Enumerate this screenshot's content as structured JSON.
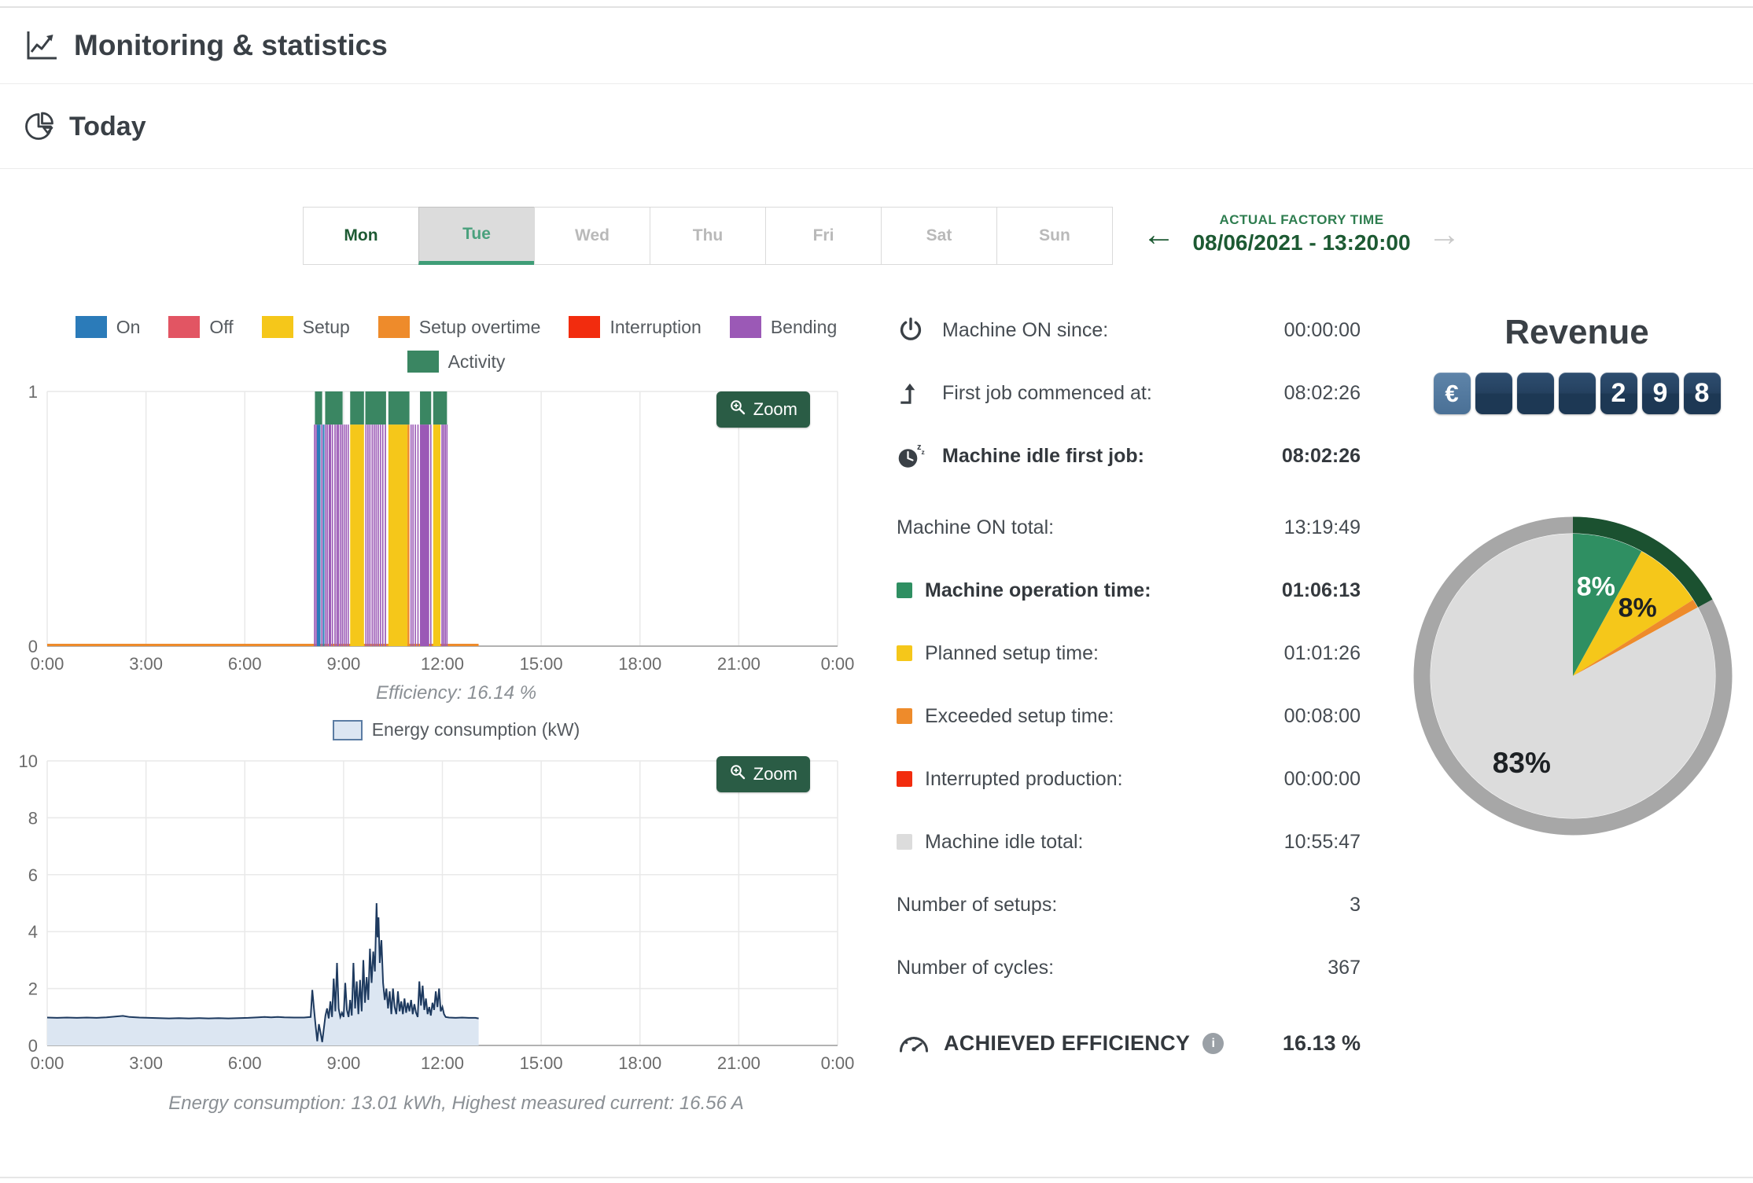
{
  "app": {
    "title": "Monitoring & statistics",
    "section_title": "Today"
  },
  "day_tabs": {
    "days": [
      {
        "label": "Mon",
        "state": "active"
      },
      {
        "label": "Tue",
        "state": "selected"
      },
      {
        "label": "Wed",
        "state": "disabled"
      },
      {
        "label": "Thu",
        "state": "disabled"
      },
      {
        "label": "Fri",
        "state": "disabled"
      },
      {
        "label": "Sat",
        "state": "disabled"
      },
      {
        "label": "Sun",
        "state": "disabled"
      }
    ]
  },
  "factory_time": {
    "label": "ACTUAL FACTORY TIME",
    "value": "08/06/2021 - 13:20:00",
    "prev_arrow": "←",
    "next_arrow": "→"
  },
  "colors": {
    "on": "#2b7bb9",
    "off": "#e25563",
    "setup": "#f5c71a",
    "setup_overtime": "#ee8b2b",
    "interruption": "#f22c0e",
    "bending": "#9b59b6",
    "activity": "#3a8662",
    "idle": "#dcdcdc",
    "pie_green": "#2f8f62",
    "ring": "#a7a7a7",
    "ring_active": "#1b5130",
    "energy_line": "#1e3a5f",
    "energy_fill": "#dce6f2",
    "accent_green": "#2a5c45",
    "dark_green_text": "#1d5a33"
  },
  "legend_activity": [
    {
      "label": "On",
      "color_key": "on"
    },
    {
      "label": "Off",
      "color_key": "off"
    },
    {
      "label": "Setup",
      "color_key": "setup"
    },
    {
      "label": "Setup overtime",
      "color_key": "setup_overtime"
    },
    {
      "label": "Interruption",
      "color_key": "interruption"
    },
    {
      "label": "Bending",
      "color_key": "bending"
    },
    {
      "label": "Activity",
      "color_key": "activity"
    }
  ],
  "chart_data": [
    {
      "id": "machine-state-timeline",
      "type": "bar",
      "x_ticks": [
        "0:00",
        "3:00",
        "6:00",
        "9:00",
        "12:00",
        "15:00",
        "18:00",
        "21:00",
        "0:00"
      ],
      "x_range": [
        0,
        24
      ],
      "y_ticks": [
        "1",
        "0"
      ],
      "y_range": [
        0,
        1
      ],
      "zoom_label": "Zoom",
      "caption": "Efficiency: 16.14 %",
      "band_top": 0.87,
      "baseline": {
        "start": 0,
        "end": 13.1,
        "color_key": "setup_overtime"
      },
      "segments": [
        {
          "s": 8.1,
          "e": 8.14,
          "c": "bending"
        },
        {
          "s": 8.15,
          "e": 8.18,
          "c": "bending"
        },
        {
          "s": 8.19,
          "e": 8.3,
          "c": "on"
        },
        {
          "s": 8.32,
          "e": 8.35,
          "c": "bending"
        },
        {
          "s": 8.37,
          "e": 8.42,
          "c": "on"
        },
        {
          "s": 8.44,
          "e": 8.47,
          "c": "bending"
        },
        {
          "s": 8.49,
          "e": 8.53,
          "c": "bending"
        },
        {
          "s": 8.55,
          "e": 8.62,
          "c": "bending"
        },
        {
          "s": 8.64,
          "e": 8.68,
          "c": "bending"
        },
        {
          "s": 8.72,
          "e": 8.76,
          "c": "bending"
        },
        {
          "s": 8.78,
          "e": 8.8,
          "c": "bending"
        },
        {
          "s": 8.82,
          "e": 8.86,
          "c": "bending"
        },
        {
          "s": 8.88,
          "e": 8.92,
          "c": "bending"
        },
        {
          "s": 8.94,
          "e": 8.97,
          "c": "bending"
        },
        {
          "s": 9.0,
          "e": 9.03,
          "c": "bending"
        },
        {
          "s": 9.06,
          "e": 9.09,
          "c": "bending"
        },
        {
          "s": 9.12,
          "e": 9.16,
          "c": "bending"
        },
        {
          "s": 9.2,
          "e": 9.62,
          "c": "setup"
        },
        {
          "s": 9.66,
          "e": 9.69,
          "c": "bending"
        },
        {
          "s": 9.72,
          "e": 9.75,
          "c": "bending"
        },
        {
          "s": 9.78,
          "e": 9.81,
          "c": "bending"
        },
        {
          "s": 9.85,
          "e": 9.88,
          "c": "bending"
        },
        {
          "s": 9.91,
          "e": 9.94,
          "c": "bending"
        },
        {
          "s": 9.97,
          "e": 10.0,
          "c": "bending"
        },
        {
          "s": 10.03,
          "e": 10.07,
          "c": "bending"
        },
        {
          "s": 10.1,
          "e": 10.13,
          "c": "bending"
        },
        {
          "s": 10.17,
          "e": 10.21,
          "c": "bending"
        },
        {
          "s": 10.25,
          "e": 10.29,
          "c": "bending"
        },
        {
          "s": 10.36,
          "e": 10.94,
          "c": "setup"
        },
        {
          "s": 10.94,
          "e": 11.0,
          "c": "setup_overtime"
        },
        {
          "s": 11.03,
          "e": 11.06,
          "c": "bending"
        },
        {
          "s": 11.09,
          "e": 11.12,
          "c": "bending"
        },
        {
          "s": 11.16,
          "e": 11.19,
          "c": "bending"
        },
        {
          "s": 11.24,
          "e": 11.27,
          "c": "bending"
        },
        {
          "s": 11.32,
          "e": 11.6,
          "c": "bending"
        },
        {
          "s": 11.63,
          "e": 11.66,
          "c": "bending"
        },
        {
          "s": 11.72,
          "e": 11.94,
          "c": "setup"
        },
        {
          "s": 11.97,
          "e": 11.99,
          "c": "bending"
        },
        {
          "s": 12.02,
          "e": 12.04,
          "c": "bending"
        },
        {
          "s": 12.07,
          "e": 12.09,
          "c": "bending"
        },
        {
          "s": 12.12,
          "e": 12.14,
          "c": "bending"
        }
      ],
      "activity_segments": [
        {
          "s": 8.13,
          "e": 8.35
        },
        {
          "s": 8.44,
          "e": 8.97
        },
        {
          "s": 9.2,
          "e": 9.62
        },
        {
          "s": 9.66,
          "e": 10.29
        },
        {
          "s": 10.36,
          "e": 11.0
        },
        {
          "s": 11.32,
          "e": 11.66
        },
        {
          "s": 11.72,
          "e": 12.14
        }
      ]
    },
    {
      "id": "energy-consumption",
      "type": "area",
      "legend": "Energy consumption (kW)",
      "x_ticks": [
        "0:00",
        "3:00",
        "6:00",
        "9:00",
        "12:00",
        "15:00",
        "18:00",
        "21:00",
        "0:00"
      ],
      "x_range": [
        0,
        24
      ],
      "y_ticks": [
        0,
        2,
        4,
        6,
        8,
        10
      ],
      "y_range": [
        0,
        10
      ],
      "zoom_label": "Zoom",
      "caption": "Energy consumption: 13.01 kWh, Highest measured current: 16.56 A",
      "points": [
        [
          0,
          0.98
        ],
        [
          0.3,
          0.97
        ],
        [
          0.6,
          0.98
        ],
        [
          0.9,
          0.97
        ],
        [
          1.2,
          0.98
        ],
        [
          1.5,
          0.97
        ],
        [
          1.8,
          0.99
        ],
        [
          2.1,
          1.02
        ],
        [
          2.3,
          1.04
        ],
        [
          2.5,
          1.0
        ],
        [
          2.8,
          0.98
        ],
        [
          3.1,
          0.97
        ],
        [
          3.4,
          0.96
        ],
        [
          3.7,
          0.95
        ],
        [
          4.0,
          0.96
        ],
        [
          4.3,
          0.95
        ],
        [
          4.6,
          0.96
        ],
        [
          4.9,
          0.95
        ],
        [
          5.2,
          0.96
        ],
        [
          5.5,
          0.95
        ],
        [
          5.8,
          0.96
        ],
        [
          6.1,
          0.97
        ],
        [
          6.4,
          0.99
        ],
        [
          6.6,
          1.0
        ],
        [
          6.8,
          0.99
        ],
        [
          7.0,
          1.0
        ],
        [
          7.2,
          0.99
        ],
        [
          7.5,
          0.98
        ],
        [
          7.8,
          0.98
        ],
        [
          8.0,
          1.0
        ],
        [
          8.05,
          1.95
        ],
        [
          8.1,
          1.3
        ],
        [
          8.15,
          0.7
        ],
        [
          8.2,
          0.15
        ],
        [
          8.25,
          0.75
        ],
        [
          8.3,
          0.45
        ],
        [
          8.35,
          0.12
        ],
        [
          8.4,
          0.6
        ],
        [
          8.45,
          1.05
        ],
        [
          8.5,
          1.3
        ],
        [
          8.55,
          0.95
        ],
        [
          8.6,
          1.55
        ],
        [
          8.65,
          1.0
        ],
        [
          8.7,
          2.35
        ],
        [
          8.75,
          1.2
        ],
        [
          8.8,
          2.9
        ],
        [
          8.85,
          1.3
        ],
        [
          8.9,
          1.0
        ],
        [
          8.95,
          1.15
        ],
        [
          9.0,
          1.0
        ],
        [
          9.05,
          2.2
        ],
        [
          9.1,
          1.25
        ],
        [
          9.15,
          1.0
        ],
        [
          9.2,
          1.6
        ],
        [
          9.25,
          1.05
        ],
        [
          9.3,
          2.9
        ],
        [
          9.35,
          1.3
        ],
        [
          9.4,
          2.25
        ],
        [
          9.45,
          1.1
        ],
        [
          9.5,
          2.3
        ],
        [
          9.55,
          1.2
        ],
        [
          9.6,
          3.0
        ],
        [
          9.65,
          1.5
        ],
        [
          9.7,
          2.4
        ],
        [
          9.75,
          1.6
        ],
        [
          9.8,
          3.4
        ],
        [
          9.85,
          2.2
        ],
        [
          9.9,
          3.3
        ],
        [
          9.95,
          2.6
        ],
        [
          10.0,
          5.0
        ],
        [
          10.03,
          3.8
        ],
        [
          10.06,
          4.5
        ],
        [
          10.1,
          2.9
        ],
        [
          10.15,
          3.7
        ],
        [
          10.2,
          2.2
        ],
        [
          10.25,
          1.6
        ],
        [
          10.3,
          2.0
        ],
        [
          10.35,
          1.3
        ],
        [
          10.4,
          1.9
        ],
        [
          10.45,
          1.1
        ],
        [
          10.5,
          2.0
        ],
        [
          10.55,
          1.35
        ],
        [
          10.6,
          1.1
        ],
        [
          10.65,
          1.9
        ],
        [
          10.7,
          1.2
        ],
        [
          10.75,
          1.55
        ],
        [
          10.8,
          1.1
        ],
        [
          10.85,
          1.65
        ],
        [
          10.9,
          1.15
        ],
        [
          10.95,
          1.5
        ],
        [
          11.0,
          1.2
        ],
        [
          11.05,
          1.6
        ],
        [
          11.1,
          1.1
        ],
        [
          11.15,
          1.45
        ],
        [
          11.2,
          1.15
        ],
        [
          11.25,
          1.0
        ],
        [
          11.3,
          2.25
        ],
        [
          11.35,
          1.4
        ],
        [
          11.4,
          2.1
        ],
        [
          11.45,
          1.25
        ],
        [
          11.5,
          1.65
        ],
        [
          11.55,
          1.1
        ],
        [
          11.6,
          1.35
        ],
        [
          11.65,
          1.05
        ],
        [
          11.7,
          1.5
        ],
        [
          11.75,
          1.25
        ],
        [
          11.8,
          1.9
        ],
        [
          11.85,
          1.35
        ],
        [
          11.9,
          2.0
        ],
        [
          11.95,
          1.2
        ],
        [
          12.0,
          1.35
        ],
        [
          12.05,
          1.1
        ],
        [
          12.1,
          1.0
        ],
        [
          12.2,
          0.98
        ],
        [
          12.4,
          0.97
        ],
        [
          12.6,
          0.98
        ],
        [
          12.8,
          0.97
        ],
        [
          13.0,
          0.97
        ],
        [
          13.1,
          0.95
        ]
      ]
    },
    {
      "id": "time-distribution-pie",
      "type": "pie",
      "ring_active_fraction": 0.17,
      "slices": [
        {
          "name": "operation",
          "pct": 8,
          "display": "8%",
          "color": "#2f8f62",
          "label_color": "#ffffff",
          "label_r": 118,
          "label_size": 34
        },
        {
          "name": "setup",
          "pct": 8,
          "display": "8%",
          "color": "#f5c71a",
          "label_color": "#1d2124",
          "label_r": 120,
          "label_size": 34
        },
        {
          "name": "exceeded",
          "pct": 1,
          "display": "",
          "color": "#ee8b2b",
          "label_color": "#1d2124",
          "label_r": 0,
          "label_size": 0
        },
        {
          "name": "idle",
          "pct": 83,
          "display": "83%",
          "color": "#dcdcdc",
          "label_color": "#1d2124",
          "label_r": 128,
          "label_size": 37
        }
      ]
    }
  ],
  "stats": {
    "rows": [
      {
        "icon": "power-icon",
        "label": "Machine ON since:",
        "value": "00:00:00"
      },
      {
        "icon": "first-job-icon",
        "label": "First job commenced at:",
        "value": "08:02:26"
      },
      {
        "icon": "idle-clock-icon",
        "label": "Machine idle first job:",
        "value": "08:02:26",
        "bold": true
      },
      {
        "label": "Machine ON total:",
        "value": "13:19:49",
        "gap": true
      },
      {
        "swatch_key": "pie_green",
        "label": "Machine operation time:",
        "value": "01:06:13",
        "bold": true
      },
      {
        "swatch_key": "setup",
        "label": "Planned setup time:",
        "value": "01:01:26"
      },
      {
        "swatch_key": "setup_overtime",
        "label": "Exceeded setup time:",
        "value": "00:08:00"
      },
      {
        "swatch_key": "interruption",
        "label": "Interrupted production:",
        "value": "00:00:00"
      },
      {
        "swatch_key": "idle",
        "label": "Machine idle total:",
        "value": "10:55:47"
      },
      {
        "label": "Number of setups:",
        "value": "3"
      },
      {
        "label": "Number of cycles:",
        "value": "367"
      }
    ]
  },
  "efficiency": {
    "label": "ACHIEVED EFFICIENCY",
    "info_glyph": "i",
    "value": "16.13 %"
  },
  "revenue": {
    "title": "Revenue",
    "tiles": [
      "€",
      "",
      "",
      "",
      "2",
      "9",
      "8"
    ]
  }
}
